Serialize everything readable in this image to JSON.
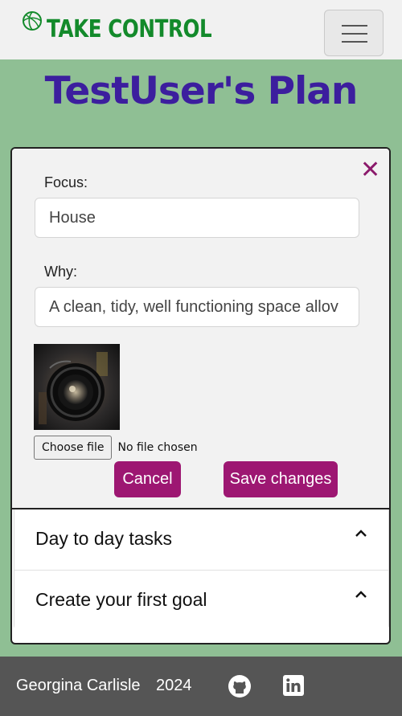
{
  "brand": {
    "name": "TAKE CONTROL",
    "color": "#138a2b"
  },
  "nav": {
    "toggle_icon": "hamburger-icon"
  },
  "page": {
    "title": "TestUser's Plan",
    "title_color": "#3c1e9e",
    "background": "#8fbf94"
  },
  "form": {
    "close_icon": "close-icon",
    "focus_label": "Focus:",
    "focus_value": "House",
    "why_label": "Why:",
    "why_value": "A clean, tidy, well functioning space allov",
    "image_alt": "camera lens photo",
    "file_button": "Choose file",
    "file_status": "No file chosen",
    "cancel_label": "Cancel",
    "save_label": "Save changes",
    "accent_color": "#9d1772"
  },
  "accordion": [
    {
      "label": "Day to day tasks",
      "icon": "chevron-up-icon"
    },
    {
      "label": "Create your first goal",
      "icon": "chevron-up-icon"
    }
  ],
  "footer": {
    "name": "Georgina Carlisle",
    "year": "2024",
    "icons": [
      "github-icon",
      "linkedin-icon"
    ]
  }
}
